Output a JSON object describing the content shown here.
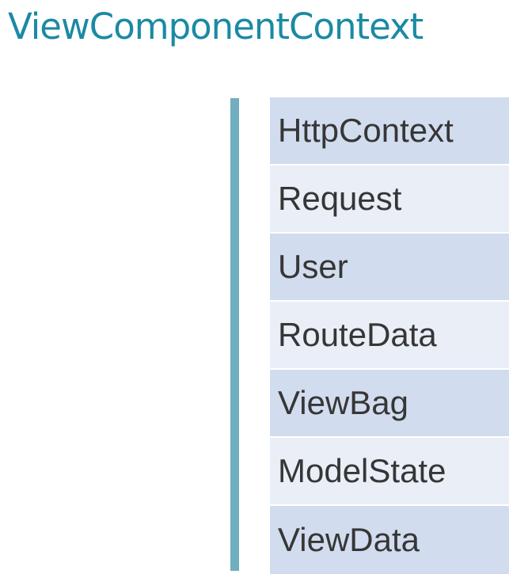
{
  "title": "ViewComponentContext",
  "items": [
    {
      "label": "HttpContext"
    },
    {
      "label": "Request"
    },
    {
      "label": "User"
    },
    {
      "label": "RouteData"
    },
    {
      "label": "ViewBag"
    },
    {
      "label": "ModelState"
    },
    {
      "label": "ViewData"
    }
  ],
  "colors": {
    "title": "#1b8aa3",
    "bar": "#71aebf",
    "item_dark": "#d1dcee",
    "item_light": "#e9eef7",
    "item_text": "#363636"
  }
}
